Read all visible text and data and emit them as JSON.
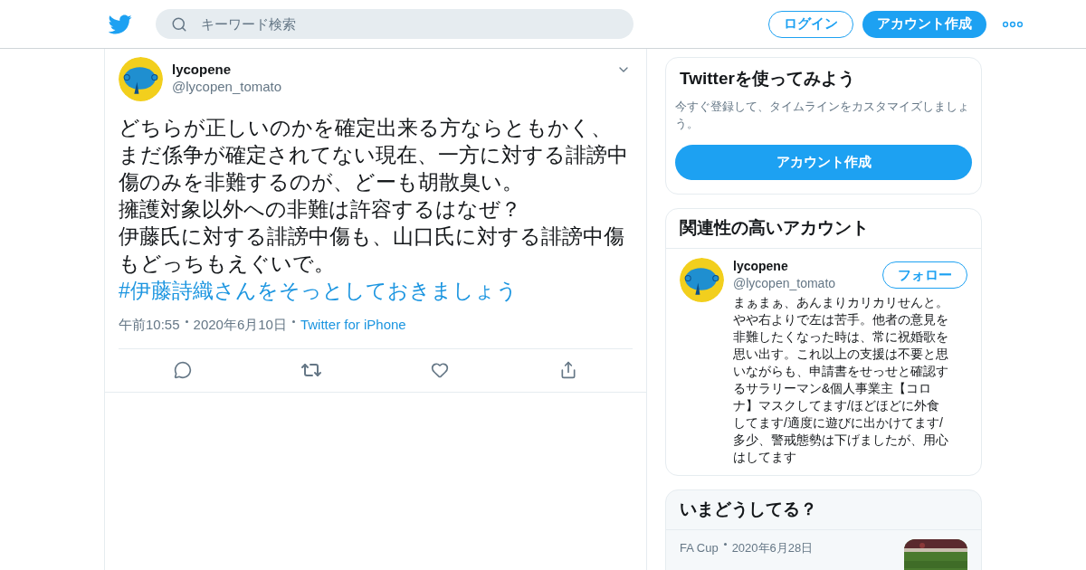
{
  "header": {
    "search": {
      "placeholder": "キーワード検索"
    },
    "login": "ログイン",
    "signup": "アカウント作成"
  },
  "tweet": {
    "name": "lycopene",
    "handle": "@lycopen_tomato",
    "lines": [
      "どちらが正しいのかを確定出来る方ならともかく、まだ係争が確定されてない現在、一方に対する誹謗中傷のみを非難するのが、どーも胡散臭い。",
      "擁護対象以外への非難は許容するはなぜ？",
      "伊藤氏に対する誹謗中傷も、山口氏に対する誹謗中傷もどっちもえぐいで。"
    ],
    "hashtag": "#伊藤詩織さんをそっとしておきましょう",
    "time": "午前10:55",
    "date": "2020年6月10日",
    "source": "Twitter for iPhone"
  },
  "signup_card": {
    "title": "Twitterを使ってみよう",
    "text": "今すぐ登録して、タイムラインをカスタマイズしましょう。",
    "button": "アカウント作成"
  },
  "related": {
    "title": "関連性の高いアカウント",
    "name": "lycopene",
    "handle": "@lycopen_tomato",
    "follow": "フォロー",
    "bio": "まぁまぁ、あんまりカリカリせんと。やや右よりで左は苦手。他者の意見を非難したくなった時は、常に祝婚歌を思い出す。これ以上の支援は不要と思いながらも、申請書をせっせと確認するサラリーマン&個人事業主【コロナ】マスクしてます/ほどほどに外食してます/適度に遊びに出かけてます/多少、警戒態勢は下げましたが、用心はしてます"
  },
  "trends": {
    "title": "いまどうしてる？",
    "items": [
      {
        "category": "FA Cup",
        "date": "2020年6月28日",
        "kind": "picture"
      }
    ]
  }
}
